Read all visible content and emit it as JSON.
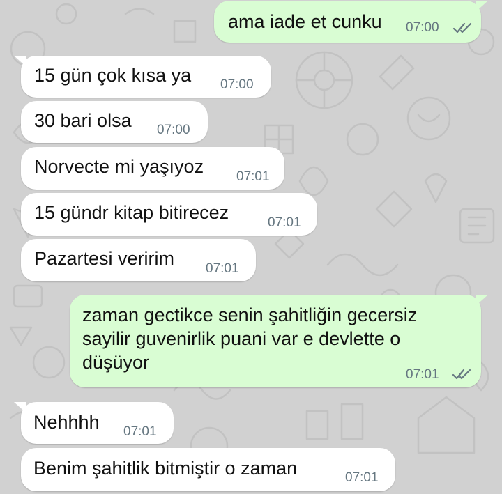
{
  "colors": {
    "wallpaper": "#d1d1d1",
    "incoming_bubble": "#ffffff",
    "outgoing_bubble": "#d9fdd3",
    "timestamp": "#667781",
    "read_ticks": "#667781"
  },
  "messages": [
    {
      "direction": "outgoing",
      "text": "ama iade et cunku",
      "time": "07:00",
      "status_icon": "double-check-icon"
    },
    {
      "direction": "incoming",
      "text": "15 gün çok kısa ya",
      "time": "07:00"
    },
    {
      "direction": "incoming",
      "text": "30 bari olsa",
      "time": "07:00"
    },
    {
      "direction": "incoming",
      "text": "Norvecte mi yaşıyoz",
      "time": "07:01"
    },
    {
      "direction": "incoming",
      "text": "15 gündr kitap bitirecez",
      "time": "07:01"
    },
    {
      "direction": "incoming",
      "text": "Pazartesi veririm",
      "time": "07:01"
    },
    {
      "direction": "outgoing",
      "text": "zaman gectikce senin şahitliğin gecersiz sayilir guvenirlik puani var e devlette o düşüyor",
      "time": "07:01",
      "status_icon": "double-check-icon"
    },
    {
      "direction": "incoming",
      "text": "Nehhhh",
      "time": "07:01"
    },
    {
      "direction": "incoming",
      "text": "Benim şahitlik bitmiştir o zaman",
      "time": "07:01"
    }
  ]
}
